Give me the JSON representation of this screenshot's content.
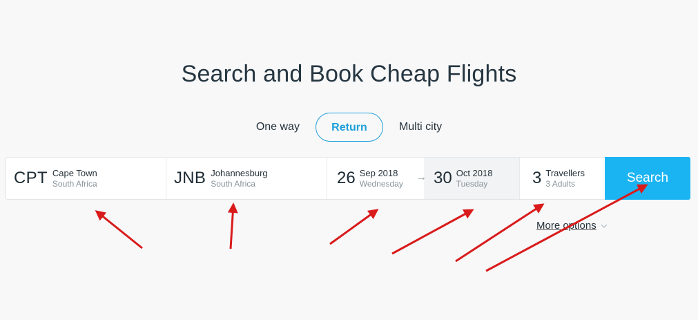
{
  "page": {
    "title": "Search and Book Cheap Flights"
  },
  "trip_types": [
    {
      "label": "One way",
      "active": false
    },
    {
      "label": "Return",
      "active": true
    },
    {
      "label": "Multi city",
      "active": false
    }
  ],
  "search": {
    "from": {
      "code": "CPT",
      "city": "Cape Town",
      "country": "South Africa"
    },
    "to": {
      "code": "JNB",
      "city": "Johannesburg",
      "country": "South Africa"
    },
    "depart": {
      "day": "26",
      "month_year": "Sep 2018",
      "weekday": "Wednesday"
    },
    "return": {
      "day": "30",
      "month_year": "Oct 2018",
      "weekday": "Tuesday"
    },
    "travellers": {
      "count": "3",
      "label": "Travellers",
      "detail": "3 Adults"
    },
    "button_label": "Search"
  },
  "more_options": {
    "label": "More options"
  },
  "colors": {
    "accent": "#1bb4f2",
    "active_tab": "#1e9fd8",
    "annotation_arrow": "#d91b1b"
  },
  "icons": {
    "date_arrow": "arrow-right-icon",
    "more_options": "chevron-down-icon"
  }
}
